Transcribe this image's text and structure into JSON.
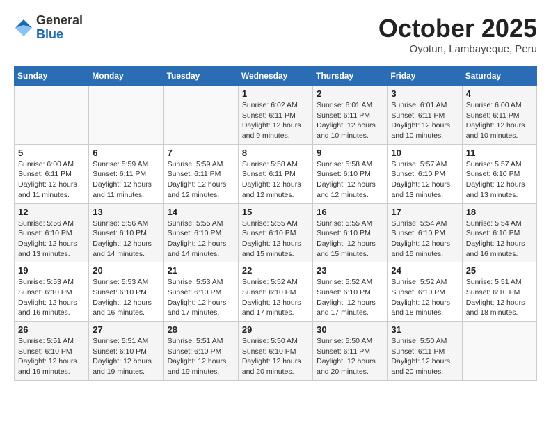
{
  "header": {
    "logo_general": "General",
    "logo_blue": "Blue",
    "month": "October 2025",
    "location": "Oyotun, Lambayeque, Peru"
  },
  "weekdays": [
    "Sunday",
    "Monday",
    "Tuesday",
    "Wednesday",
    "Thursday",
    "Friday",
    "Saturday"
  ],
  "weeks": [
    [
      {
        "day": "",
        "info": ""
      },
      {
        "day": "",
        "info": ""
      },
      {
        "day": "",
        "info": ""
      },
      {
        "day": "1",
        "info": "Sunrise: 6:02 AM\nSunset: 6:11 PM\nDaylight: 12 hours and 9 minutes."
      },
      {
        "day": "2",
        "info": "Sunrise: 6:01 AM\nSunset: 6:11 PM\nDaylight: 12 hours and 10 minutes."
      },
      {
        "day": "3",
        "info": "Sunrise: 6:01 AM\nSunset: 6:11 PM\nDaylight: 12 hours and 10 minutes."
      },
      {
        "day": "4",
        "info": "Sunrise: 6:00 AM\nSunset: 6:11 PM\nDaylight: 12 hours and 10 minutes."
      }
    ],
    [
      {
        "day": "5",
        "info": "Sunrise: 6:00 AM\nSunset: 6:11 PM\nDaylight: 12 hours and 11 minutes."
      },
      {
        "day": "6",
        "info": "Sunrise: 5:59 AM\nSunset: 6:11 PM\nDaylight: 12 hours and 11 minutes."
      },
      {
        "day": "7",
        "info": "Sunrise: 5:59 AM\nSunset: 6:11 PM\nDaylight: 12 hours and 12 minutes."
      },
      {
        "day": "8",
        "info": "Sunrise: 5:58 AM\nSunset: 6:11 PM\nDaylight: 12 hours and 12 minutes."
      },
      {
        "day": "9",
        "info": "Sunrise: 5:58 AM\nSunset: 6:10 PM\nDaylight: 12 hours and 12 minutes."
      },
      {
        "day": "10",
        "info": "Sunrise: 5:57 AM\nSunset: 6:10 PM\nDaylight: 12 hours and 13 minutes."
      },
      {
        "day": "11",
        "info": "Sunrise: 5:57 AM\nSunset: 6:10 PM\nDaylight: 12 hours and 13 minutes."
      }
    ],
    [
      {
        "day": "12",
        "info": "Sunrise: 5:56 AM\nSunset: 6:10 PM\nDaylight: 12 hours and 13 minutes."
      },
      {
        "day": "13",
        "info": "Sunrise: 5:56 AM\nSunset: 6:10 PM\nDaylight: 12 hours and 14 minutes."
      },
      {
        "day": "14",
        "info": "Sunrise: 5:55 AM\nSunset: 6:10 PM\nDaylight: 12 hours and 14 minutes."
      },
      {
        "day": "15",
        "info": "Sunrise: 5:55 AM\nSunset: 6:10 PM\nDaylight: 12 hours and 15 minutes."
      },
      {
        "day": "16",
        "info": "Sunrise: 5:55 AM\nSunset: 6:10 PM\nDaylight: 12 hours and 15 minutes."
      },
      {
        "day": "17",
        "info": "Sunrise: 5:54 AM\nSunset: 6:10 PM\nDaylight: 12 hours and 15 minutes."
      },
      {
        "day": "18",
        "info": "Sunrise: 5:54 AM\nSunset: 6:10 PM\nDaylight: 12 hours and 16 minutes."
      }
    ],
    [
      {
        "day": "19",
        "info": "Sunrise: 5:53 AM\nSunset: 6:10 PM\nDaylight: 12 hours and 16 minutes."
      },
      {
        "day": "20",
        "info": "Sunrise: 5:53 AM\nSunset: 6:10 PM\nDaylight: 12 hours and 16 minutes."
      },
      {
        "day": "21",
        "info": "Sunrise: 5:53 AM\nSunset: 6:10 PM\nDaylight: 12 hours and 17 minutes."
      },
      {
        "day": "22",
        "info": "Sunrise: 5:52 AM\nSunset: 6:10 PM\nDaylight: 12 hours and 17 minutes."
      },
      {
        "day": "23",
        "info": "Sunrise: 5:52 AM\nSunset: 6:10 PM\nDaylight: 12 hours and 17 minutes."
      },
      {
        "day": "24",
        "info": "Sunrise: 5:52 AM\nSunset: 6:10 PM\nDaylight: 12 hours and 18 minutes."
      },
      {
        "day": "25",
        "info": "Sunrise: 5:51 AM\nSunset: 6:10 PM\nDaylight: 12 hours and 18 minutes."
      }
    ],
    [
      {
        "day": "26",
        "info": "Sunrise: 5:51 AM\nSunset: 6:10 PM\nDaylight: 12 hours and 19 minutes."
      },
      {
        "day": "27",
        "info": "Sunrise: 5:51 AM\nSunset: 6:10 PM\nDaylight: 12 hours and 19 minutes."
      },
      {
        "day": "28",
        "info": "Sunrise: 5:51 AM\nSunset: 6:10 PM\nDaylight: 12 hours and 19 minutes."
      },
      {
        "day": "29",
        "info": "Sunrise: 5:50 AM\nSunset: 6:10 PM\nDaylight: 12 hours and 20 minutes."
      },
      {
        "day": "30",
        "info": "Sunrise: 5:50 AM\nSunset: 6:11 PM\nDaylight: 12 hours and 20 minutes."
      },
      {
        "day": "31",
        "info": "Sunrise: 5:50 AM\nSunset: 6:11 PM\nDaylight: 12 hours and 20 minutes."
      },
      {
        "day": "",
        "info": ""
      }
    ]
  ]
}
